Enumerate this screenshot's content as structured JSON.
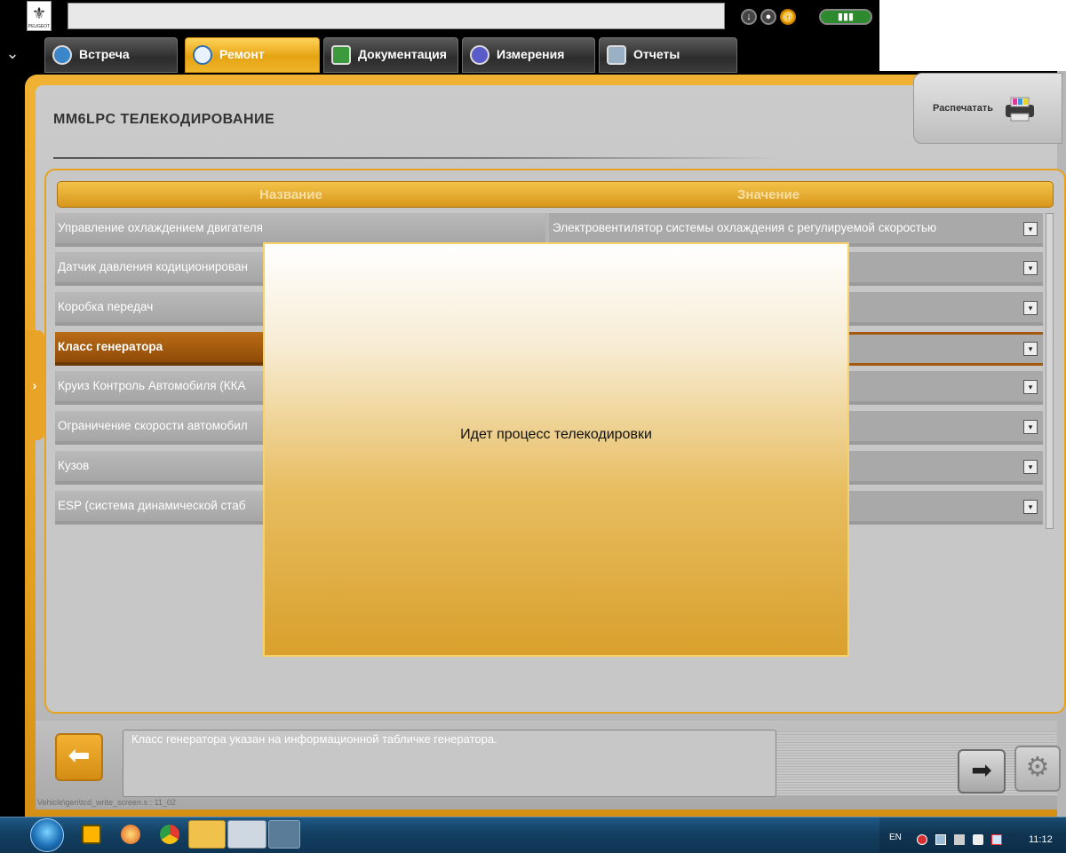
{
  "topbar": {
    "brand_text": "PEUGEOT"
  },
  "tabs": [
    {
      "label": "Встреча",
      "active": false
    },
    {
      "label": "Ремонт",
      "active": true
    },
    {
      "label": "Документация",
      "active": false
    },
    {
      "label": "Измерения",
      "active": false
    },
    {
      "label": "Отчеты",
      "active": false
    }
  ],
  "page": {
    "title": "MM6LPC  ТЕЛЕКОДИРОВАНИЕ",
    "print_label": "Распечатать"
  },
  "table": {
    "col_name": "Название",
    "col_value": "Значение",
    "rows": [
      {
        "name": "Управление охлаждением двигателя",
        "value": "Электровентилятор системы охлаждения с регулируемой скоростью"
      },
      {
        "name": "Датчик давления кодиционирован",
        "value": ""
      },
      {
        "name": "Коробка передач",
        "value": ""
      },
      {
        "name": "Класс генератора",
        "value": "",
        "selected": true
      },
      {
        "name": "Круиз Контроль Автомобиля (ККА",
        "value": ""
      },
      {
        "name": "Ограничение скорости автомобил",
        "value": ""
      },
      {
        "name": "Кузов",
        "value": ""
      },
      {
        "name": "ESP (система динамической стаб",
        "value": ""
      }
    ]
  },
  "modal": {
    "message": "Идет процесс телекодировки"
  },
  "footer": {
    "info_text": "Класс генератора указан на информационной табличке генератора.",
    "screen_path": "Vehicle\\gen\\tcd_write_screen.s : 11_02"
  },
  "taskbar": {
    "lang": "EN",
    "time": "11:12"
  },
  "colors": {
    "accent_orange": "#e59f1e",
    "selected_row": "#8f4b07"
  }
}
